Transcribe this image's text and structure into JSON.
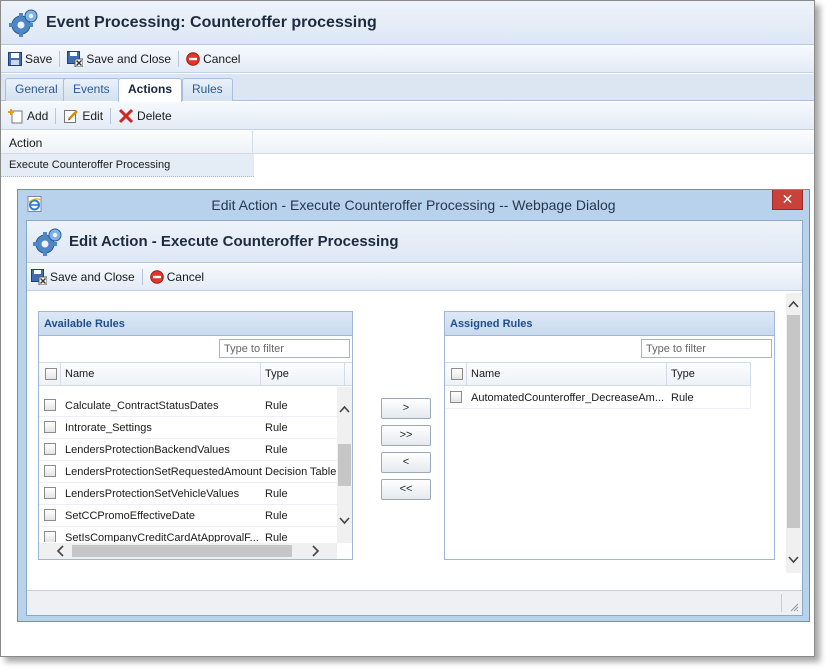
{
  "app": {
    "title": "Event Processing: Counteroffer processing",
    "toolbar": {
      "save": "Save",
      "save_close": "Save and Close",
      "cancel": "Cancel"
    },
    "tabs": [
      {
        "label": "General",
        "active": false
      },
      {
        "label": "Events",
        "active": false
      },
      {
        "label": "Actions",
        "active": true
      },
      {
        "label": "Rules",
        "active": false
      }
    ],
    "actions_toolbar": {
      "add": "Add",
      "edit": "Edit",
      "delete": "Delete"
    },
    "grid": {
      "column": "Action",
      "rows": [
        "Execute Counteroffer Processing"
      ]
    }
  },
  "dialog": {
    "window_title": "Edit Action - Execute Counteroffer Processing -- Webpage Dialog",
    "close_glyph": "✕",
    "header_title": "Edit Action - Execute Counteroffer Processing",
    "toolbar": {
      "save_close": "Save and Close",
      "cancel": "Cancel"
    },
    "available": {
      "title": "Available Rules",
      "filter_placeholder": "Type to filter",
      "col_name": "Name",
      "col_type": "Type",
      "rows": [
        {
          "name": "Calculate_ContractStatusDates",
          "type": "Rule"
        },
        {
          "name": "Introrate_Settings",
          "type": "Rule"
        },
        {
          "name": "LendersProtectionBackendValues",
          "type": "Rule"
        },
        {
          "name": "LendersProtectionSetRequestedAmount",
          "type": "Decision Table"
        },
        {
          "name": "LendersProtectionSetVehicleValues",
          "type": "Rule"
        },
        {
          "name": "SetCCPromoEffectiveDate",
          "type": "Rule"
        },
        {
          "name": "SetIsCompanyCreditCardAtApprovalF...",
          "type": "Rule"
        }
      ]
    },
    "assigned": {
      "title": "Assigned Rules",
      "filter_placeholder": "Type to filter",
      "col_name": "Name",
      "col_type": "Type",
      "rows": [
        {
          "name": "AutomatedCounteroffer_DecreaseAm...",
          "type": "Rule"
        }
      ]
    },
    "move_buttons": {
      "add_one": ">",
      "add_all": ">>",
      "remove_one": "<",
      "remove_all": "<<"
    }
  },
  "colors": {
    "accent": "#1e4e8c",
    "dialog_frame": "#b9d2ec",
    "close": "#c8413a"
  }
}
